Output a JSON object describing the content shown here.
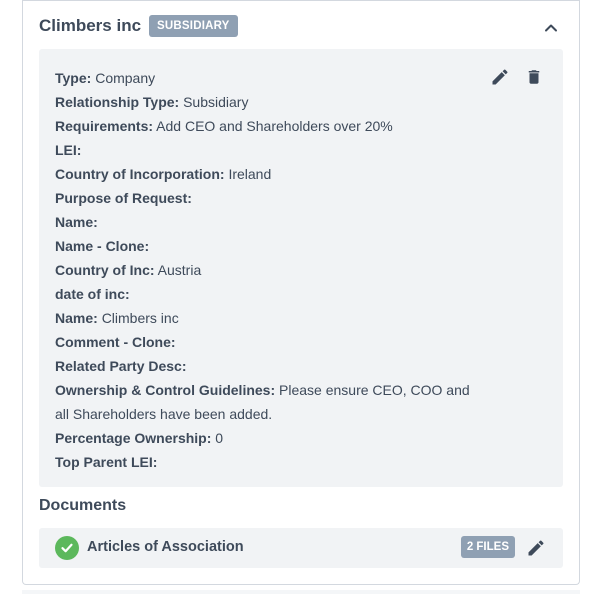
{
  "entity": {
    "name": "Climbers inc",
    "badge": "SUBSIDIARY"
  },
  "fields": [
    {
      "label": "Type:",
      "value": "Company"
    },
    {
      "label": "Relationship Type:",
      "value": "Subsidiary"
    },
    {
      "label": "Requirements:",
      "value": "Add CEO and Shareholders over 20%"
    },
    {
      "label": "LEI:",
      "value": ""
    },
    {
      "label": "Country of Incorporation:",
      "value": "Ireland"
    },
    {
      "label": "Purpose of Request:",
      "value": ""
    },
    {
      "label": "Name:",
      "value": ""
    },
    {
      "label": "Name - Clone:",
      "value": ""
    },
    {
      "label": "Country of Inc:",
      "value": "Austria"
    },
    {
      "label": "date of inc:",
      "value": ""
    },
    {
      "label": "Name:",
      "value": "Climbers inc"
    },
    {
      "label": "Comment - Clone:",
      "value": ""
    },
    {
      "label": "Related Party Desc:",
      "value": ""
    },
    {
      "label": "Ownership & Control Guidelines:",
      "value": "Please ensure CEO, COO and all Shareholders have been added."
    },
    {
      "label": "Percentage Ownership:",
      "value": "0"
    },
    {
      "label": "Top Parent LEI:",
      "value": ""
    }
  ],
  "documents": {
    "title": "Documents",
    "items": [
      {
        "name": "Articles of Association",
        "files_badge": "2 FILES",
        "status": "complete"
      }
    ]
  },
  "icons": {
    "collapse": "chevron-up-icon",
    "edit": "pencil-icon",
    "delete": "trash-icon",
    "status": "check-circle-icon"
  },
  "colors": {
    "badge": "#8fa0b3",
    "panel": "#f1f3f5",
    "text": "#3e4a5a",
    "success": "#5cb85c"
  }
}
